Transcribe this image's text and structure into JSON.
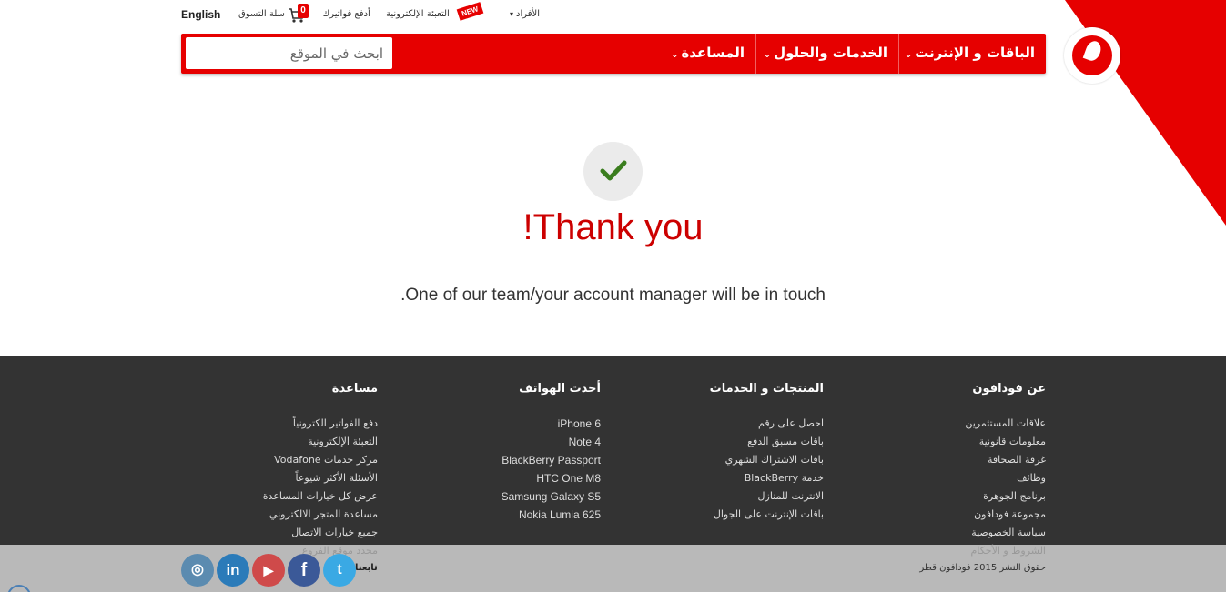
{
  "utility": {
    "english": "English",
    "cart_label": "سلة التسوق",
    "cart_count": "0",
    "pay_bills": "أدفع فواتيرك",
    "etopup": "التعبئة الإلكترونية",
    "new_badge": "NEW",
    "personal": "الأفراد"
  },
  "nav": {
    "item1": "الباقات و الإنترنت",
    "item2": "الخدمات والحلول",
    "item3": "المساعدة",
    "search_placeholder": "ابحث في الموقع"
  },
  "confirmation": {
    "title": "!Thank you",
    "message": ".One of our team/your account manager will be in touch"
  },
  "footer": {
    "about": {
      "heading": "عن فودافون",
      "links": [
        "علاقات المستثمرين",
        "معلومات قانونية",
        "غرفة الصحافة",
        "وظائف",
        "برنامج الجوهرة",
        "مجموعة فودافون",
        "سياسة الخصوصية",
        "الشروط و الأحكام"
      ]
    },
    "products": {
      "heading": "المنتجات و الخدمات",
      "links": [
        "احصل على رقم",
        "باقات مسبق الدفع",
        "باقات الاشتراك الشهري",
        "خدمة BlackBerry",
        "الانترنت للمنازل",
        "باقات الإنترنت على الجوال"
      ]
    },
    "phones": {
      "heading": "أحدث الهواتف",
      "links": [
        "iPhone 6",
        "Note 4",
        "BlackBerry Passport",
        "HTC One M8",
        "Samsung Galaxy S5",
        "Nokia Lumia 625"
      ]
    },
    "help": {
      "heading": "مساعدة",
      "links": [
        "دفع الفواتير الكترونياً",
        "التعبئة الإلكترونية",
        "مركز خدمات Vodafone",
        "الأسئلة الأكثر شيوعاً",
        "عرض كل خيارات المساعدة",
        "مساعدة المتجر الالكتروني",
        "جميع خيارات الاتصال",
        "محدد موقع الفروع"
      ]
    },
    "copyright": "حقوق النشر 2015 فودافون قطر",
    "follow_label": "تابعنا",
    "social": {
      "instagram": "◎",
      "linkedin": "in",
      "youtube": "▶",
      "facebook": "f",
      "twitter": "t"
    }
  },
  "colors": {
    "brand_red": "#e60000",
    "footer_bg": "#333333",
    "check_green": "#3a7d1e"
  }
}
